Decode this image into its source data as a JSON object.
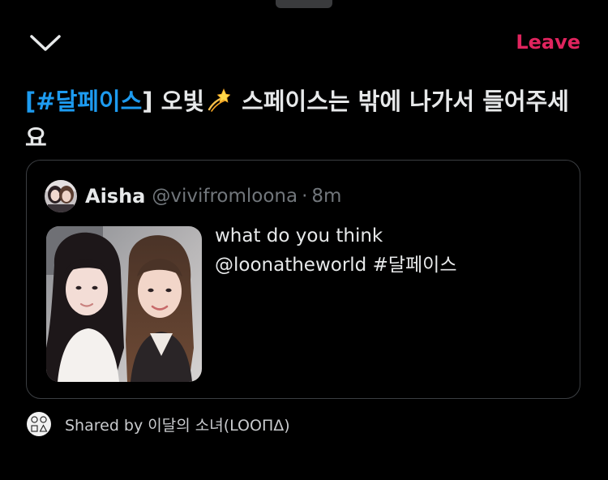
{
  "header": {
    "collapse_icon": "chevron-down-icon",
    "leave_label": "Leave",
    "leave_color": "#e0245e"
  },
  "space": {
    "title_hashtag_open": "[",
    "title_hashtag": "#달페이스",
    "title_hashtag_close": "]",
    "title_part1": "오빛",
    "title_emoji_icon": "dizzy-star-icon",
    "title_part2": "스페이스는 밖에 나가서 들어주세요",
    "hashtag_color": "#1d9bf0"
  },
  "tweet": {
    "author_name": "Aisha",
    "author_handle": "@vivifromloona",
    "separator": "·",
    "time": "8m",
    "text_line1": "what do you think",
    "mention": "@loonatheworld",
    "hashtag": "#달페이스"
  },
  "shared": {
    "prefix": "Shared by",
    "name": "이달의 소녀(LOOΠΔ)"
  }
}
